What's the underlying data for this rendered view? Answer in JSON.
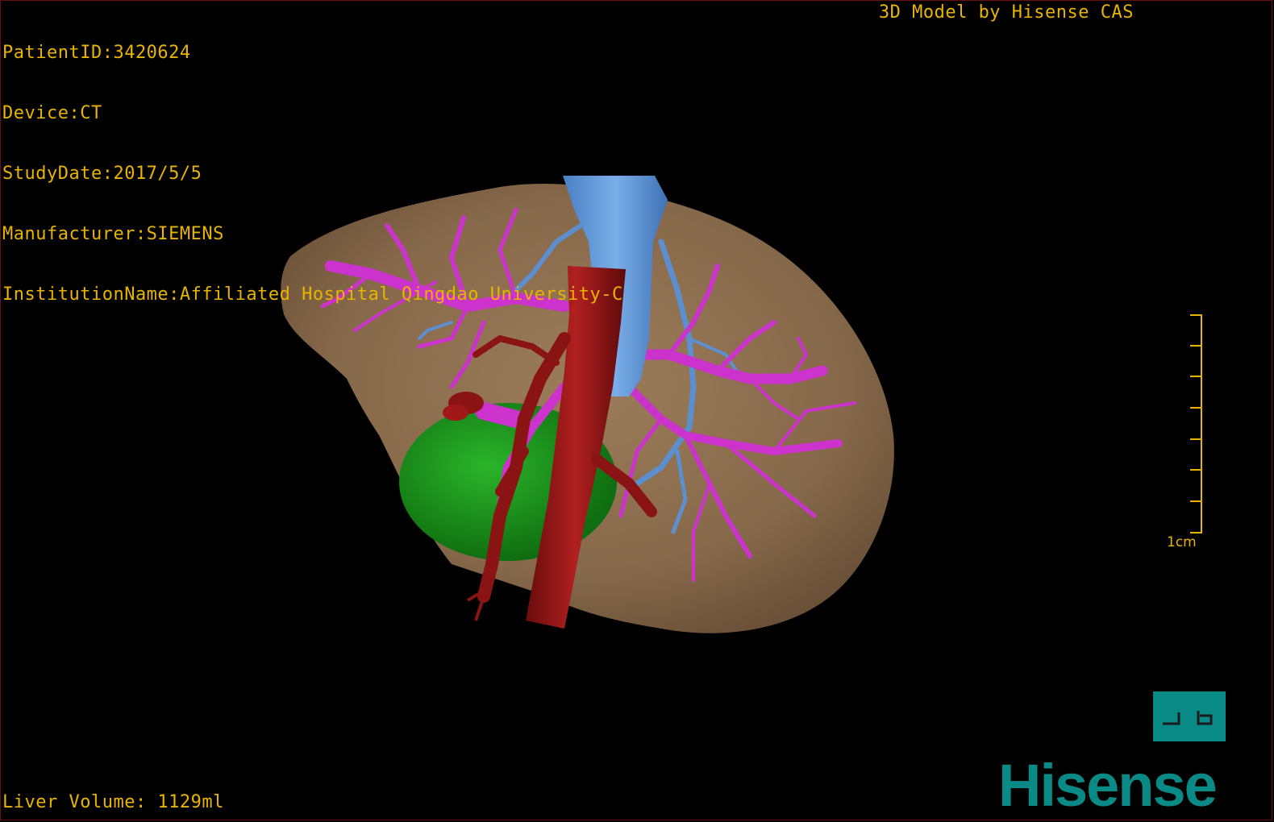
{
  "metadata": {
    "patient_id": "PatientID:3420624",
    "device": "Device:CT",
    "study_date": "StudyDate:2017/5/5",
    "manufacturer": "Manufacturer:SIEMENS",
    "institution": "InstitutionName:Affiliated Hospital Qingdao University-C"
  },
  "model_credit": "3D Model by Hisense CAS",
  "liver_volume": "Liver Volume: 1129ml",
  "scale": {
    "label": "1cm"
  },
  "brand": {
    "name": "Hisense",
    "color": "#0a8a86"
  },
  "colors": {
    "overlay_text": "#e8b400",
    "liver": "#8b6d4c",
    "portal_vein": "#cc33cc",
    "hepatic_vein": "#5b8fd0",
    "artery": "#8a1414",
    "gallbladder": "#1e9a1e"
  },
  "icons": {
    "toggle_view": "split-view-icon"
  }
}
